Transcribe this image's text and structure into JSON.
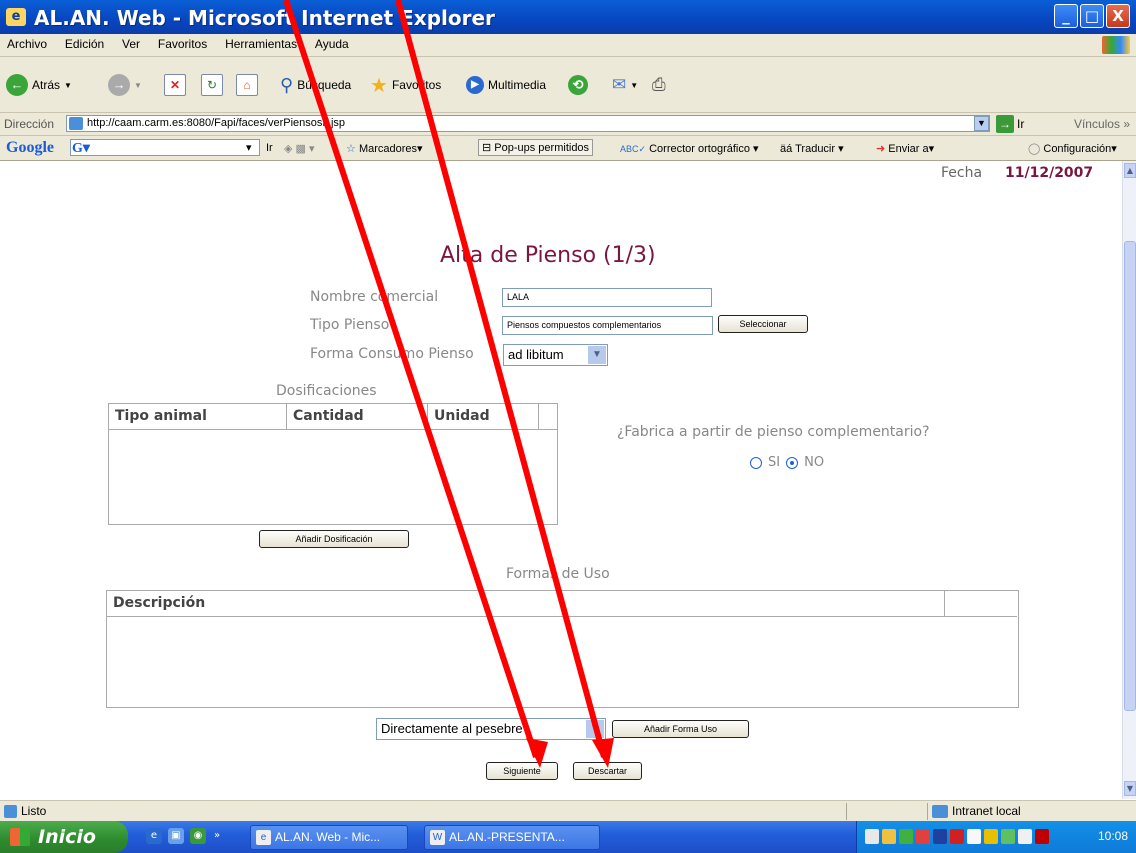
{
  "window": {
    "title": "AL.AN. Web - Microsoft Internet Explorer",
    "controls": {
      "minimize": "_",
      "maximize": "□",
      "close": "X"
    }
  },
  "menu": [
    "Archivo",
    "Edición",
    "Ver",
    "Favoritos",
    "Herramientas",
    "Ayuda"
  ],
  "toolbar": {
    "back": "Atrás",
    "search": "Búsqueda",
    "favorites": "Favoritos",
    "multimedia": "Multimedia"
  },
  "address": {
    "label": "Dirección",
    "url": "http://caam.carm.es:8080/Fapi/faces/verPiensosF.jsp",
    "go": "Ir",
    "links": "Vínculos"
  },
  "google": {
    "logo": "Google",
    "ir": "Ir",
    "bookmarks": "Marcadores",
    "popups": "Pop-ups permitidos",
    "spell": "Corrector ortográfico",
    "translate": "Traducir",
    "send": "Enviar a",
    "settings": "Configuración"
  },
  "form": {
    "fecha_label": "Fecha",
    "fecha_value": "11/12/2007",
    "title": "Alta de Pienso (1/3)",
    "nombre_label": "Nombre comercial",
    "nombre_value": "LALA",
    "tipo_label": "Tipo Pienso",
    "tipo_value": "Piensos compuestos  complementarios",
    "seleccionar": "Seleccionar",
    "forma_label": "Forma Consumo Pienso",
    "forma_value": "ad libitum",
    "dosificaciones_title": "Dosificaciones",
    "dos_headers": [
      "Tipo animal",
      "Cantidad",
      "Unidad"
    ],
    "anadir_dosificacion": "Añadir Dosificación",
    "question": "¿Fabrica a partir de pienso complementario?",
    "radio_si": "SI",
    "radio_no": "NO",
    "radio_selected": "NO",
    "formas_title": "Formas de Uso",
    "formas_header": "Descripción",
    "forma_uso_value": "Directamente al pesebre",
    "anadir_forma": "Añadir Forma Uso",
    "siguiente": "Siguiente",
    "descartar": "Descartar"
  },
  "status": {
    "text": "Listo",
    "zone": "Intranet local"
  },
  "taskbar": {
    "start": "Inicio",
    "tasks": [
      "AL.AN. Web - Mic...",
      "AL.AN.-PRESENTA..."
    ],
    "clock": "10:08"
  },
  "annotation_color": "#ff0000"
}
